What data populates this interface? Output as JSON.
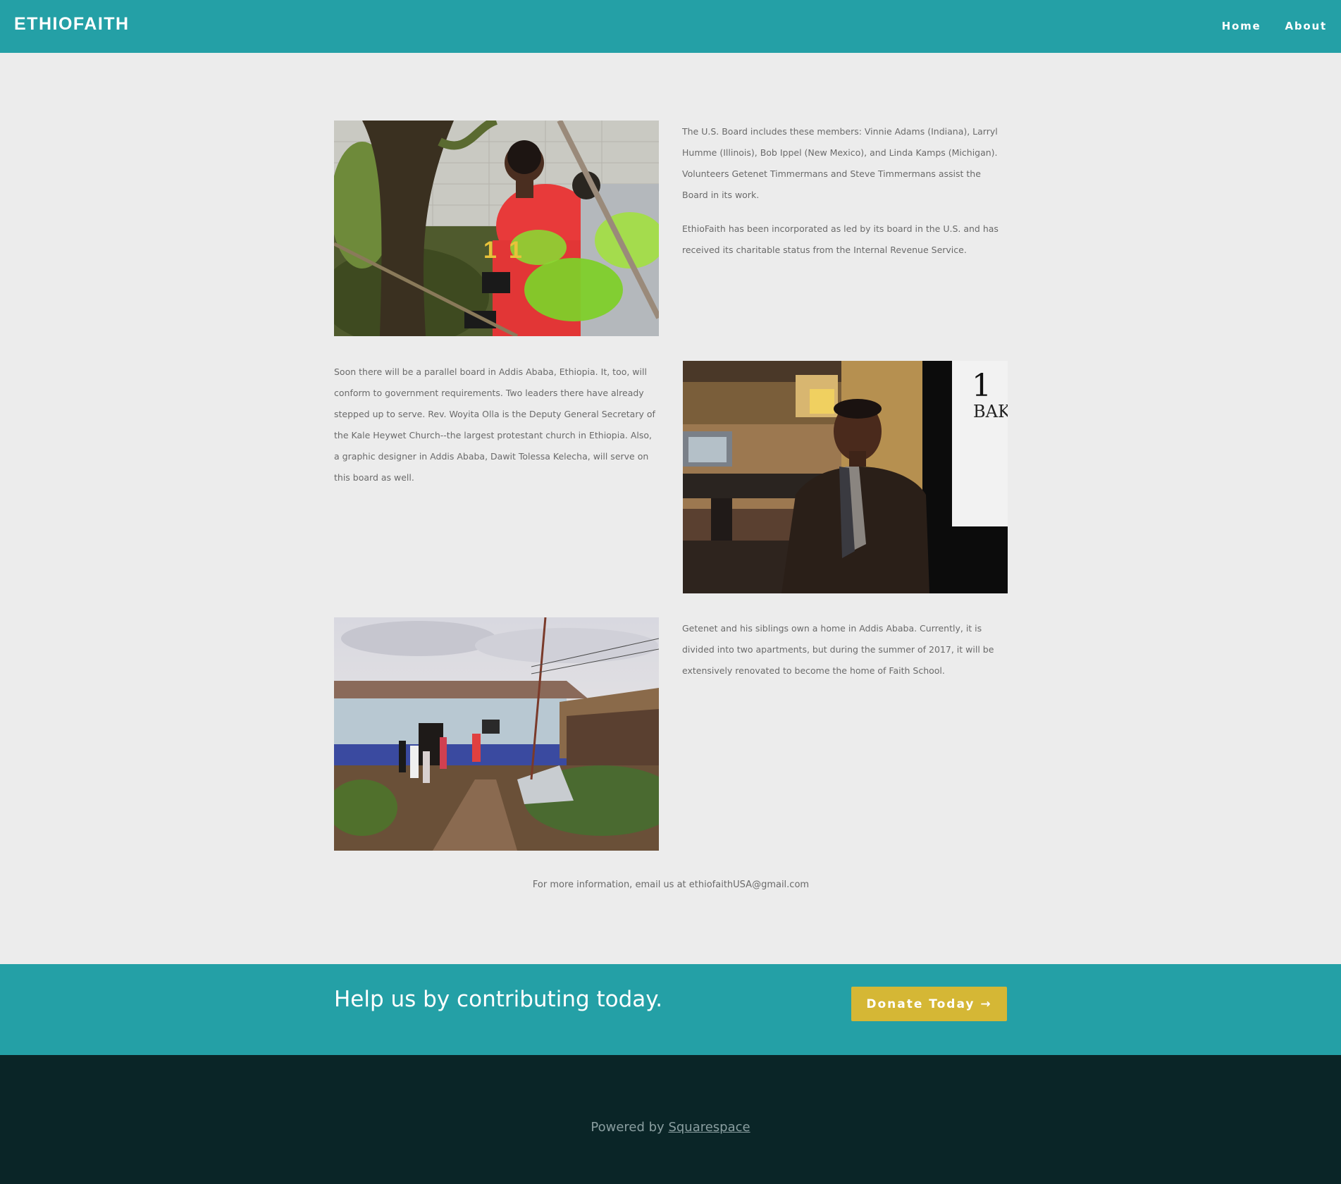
{
  "header": {
    "logo": "ETHIOFAITH",
    "nav": [
      {
        "label": "Home"
      },
      {
        "label": "About"
      }
    ]
  },
  "sections": [
    {
      "paragraphs": [
        "The U.S. Board includes these members:  Vinnie Adams (Indiana), Larryl Humme (Illinois), Bob Ippel (New Mexico), and Linda Kamps (Michigan).  Volunteers Getenet Timmermans and Steve Timmermans assist the Board in its work.",
        "EthioFaith has been incorporated as led by its board in the U.S. and has received its charitable status from the Internal Revenue Service."
      ]
    },
    {
      "paragraphs": [
        "Soon there will be a parallel board in Addis Ababa, Ethiopia.  It, too, will conform to government requirements.  Two leaders there have already stepped up to serve. Rev. Woyita Olla is the Deputy General Secretary of the Kale Heywet Church--the largest protestant church in Ethiopia.  Also, a graphic designer in Addis Ababa, Dawit Tolessa Kelecha, will serve on this board as well."
      ]
    },
    {
      "paragraphs": [
        "Getenet and his siblings own a home in Addis Ababa.  Currently, it is divided into two apartments, but during the summer of 2017, it will be extensively renovated to become the home of Faith School."
      ]
    }
  ],
  "contact": "For more information, email us at ethiofaithUSA@gmail.com",
  "donate_band": {
    "text": "Help us by contributing today.",
    "button": "Donate Today →"
  },
  "footer": {
    "prefix": "Powered by ",
    "link": "Squarespace"
  },
  "colors": {
    "header": "#24a0a6",
    "background": "#ececec",
    "button": "#d5b735",
    "footer": "#0a2527"
  }
}
